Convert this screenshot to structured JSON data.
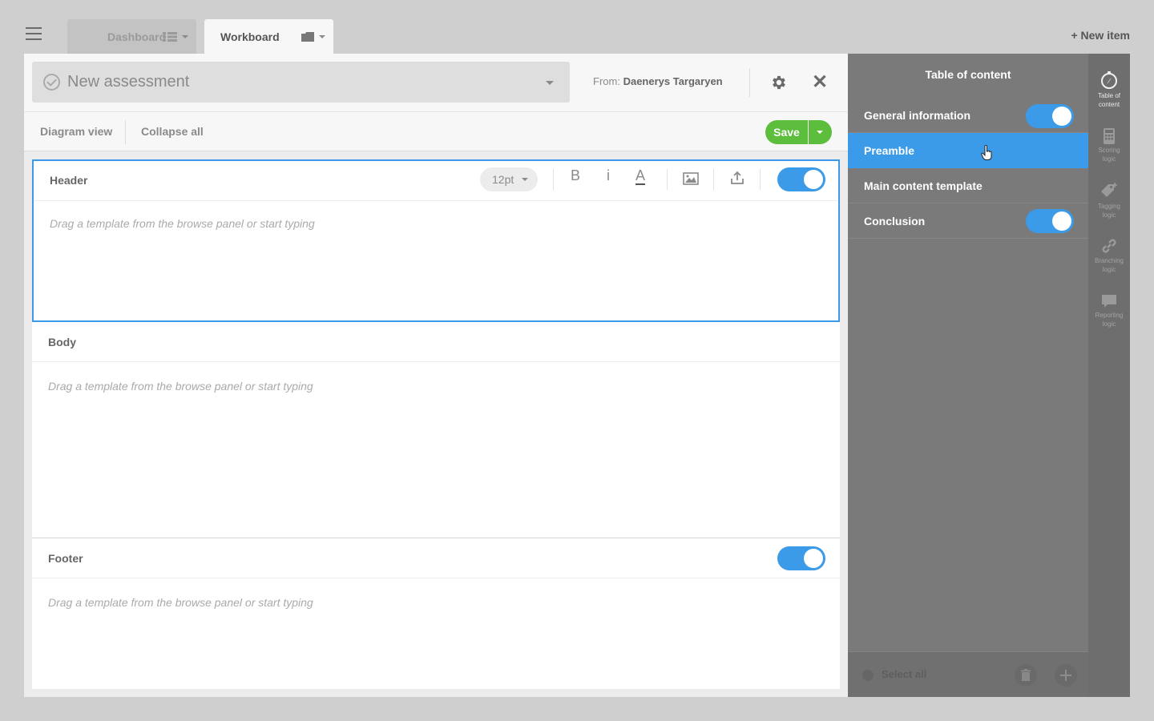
{
  "topbar": {
    "tabs": [
      {
        "label": "Dashboard",
        "icon": "grid-icon"
      },
      {
        "label": "Workboard",
        "icon": "folder-icon"
      }
    ],
    "new_item": "+ New item"
  },
  "title_bar": {
    "title_value": "New assessment",
    "from_label": "From:",
    "from_name": "Daenerys Targaryen"
  },
  "toolbar": {
    "diagram_view": "Diagram view",
    "collapse_all": "Collapse all",
    "save": "Save"
  },
  "sections": {
    "header": {
      "title": "Header",
      "placeholder": "Drag a template from the browse panel or start typing",
      "enabled": true
    },
    "body": {
      "title": "Body",
      "placeholder": "Drag a template from the browse panel or start typing"
    },
    "footer": {
      "title": "Footer",
      "placeholder": "Drag a template from the browse panel or start typing",
      "enabled": true
    }
  },
  "format_toolbar": {
    "font_size": "12pt",
    "bold": "B",
    "italic": "i",
    "color": "A"
  },
  "toc": {
    "title": "Table of content",
    "items": [
      {
        "label": "General information",
        "toggle": true
      },
      {
        "label": "Preamble",
        "active": true
      },
      {
        "label": "Main content template"
      },
      {
        "label": "Conclusion",
        "toggle": true
      }
    ],
    "select_all": "Select all"
  },
  "rail": [
    {
      "line1": "Table of",
      "line2": "content",
      "icon": "compass-icon"
    },
    {
      "line1": "Scoring",
      "line2": "logic",
      "icon": "calculator-icon"
    },
    {
      "line1": "Tagging",
      "line2": "logic",
      "icon": "tag-icon"
    },
    {
      "line1": "Branching",
      "line2": "logic",
      "icon": "link-icon"
    },
    {
      "line1": "Reporting",
      "line2": "logic",
      "icon": "speech-bubble-icon"
    }
  ],
  "colors": {
    "accent": "#3b9be8",
    "save_green": "#5cbe3c",
    "panel_gray": "#7a7a7a"
  }
}
